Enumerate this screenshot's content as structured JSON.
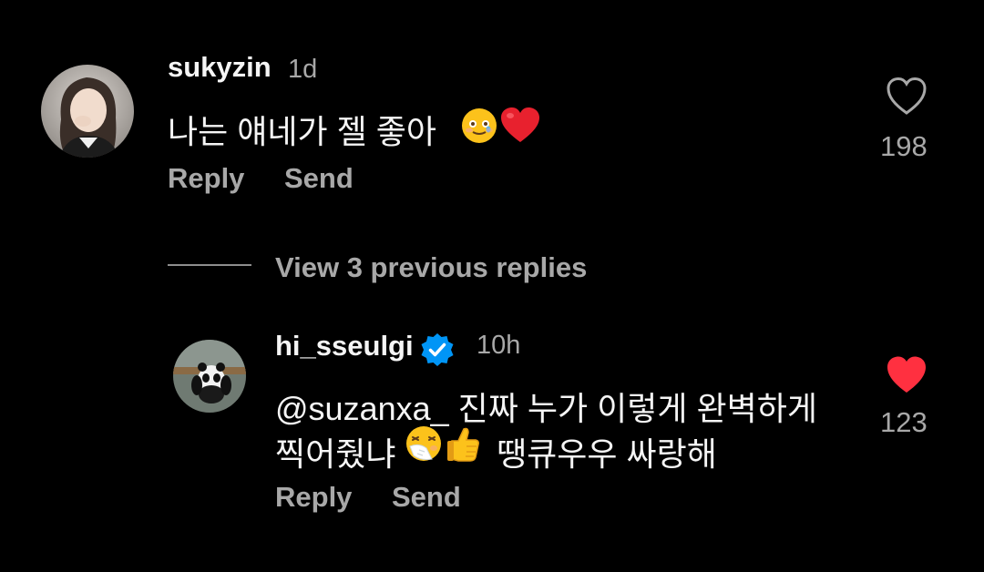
{
  "comments": [
    {
      "username": "sukyzin",
      "time": "1d",
      "text": "나는 얘네가 젤 좋아",
      "emojis": [
        "smiling-face-with-tear-emoji",
        "red-heart-emoji"
      ],
      "actions": {
        "reply": "Reply",
        "send": "Send"
      },
      "like_count": "198",
      "liked": false,
      "verified": false
    },
    {
      "username": "hi_sseulgi",
      "time": "10h",
      "text_line1": "@suzanxa_ 진짜 누가 이렇게 완벽하게",
      "text_line2_before": "찍어줬냐",
      "text_line2_after": "땡큐우우 싸랑해",
      "emojis": [
        "sneezing-face-emoji",
        "thumbs-up-emoji"
      ],
      "actions": {
        "reply": "Reply",
        "send": "Send"
      },
      "like_count": "123",
      "liked": true,
      "verified": true
    }
  ],
  "thread": {
    "view_replies_label": "View 3 previous replies"
  },
  "colors": {
    "background": "#000000",
    "primary_text": "#f5f5f5",
    "secondary_text": "#a8a8a8",
    "liked_heart": "#ff3040",
    "verified_badge": "#0095f6"
  }
}
